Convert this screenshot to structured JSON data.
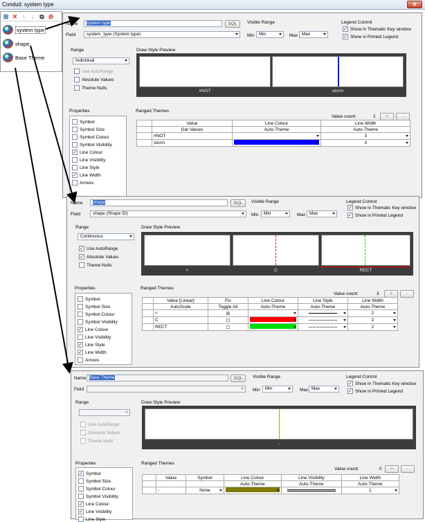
{
  "window": {
    "title": "Conduit: system type",
    "close_glyph": "✕"
  },
  "tree": {
    "items": [
      {
        "label": "system type",
        "selected": true
      },
      {
        "label": "shape",
        "selected": false
      },
      {
        "label": "Base Theme",
        "selected": false
      }
    ]
  },
  "labels": {
    "name": "Name",
    "field": "Field",
    "sql": "SQL",
    "visible_range": "Visible Range",
    "min": "Min",
    "max": "Max",
    "legend_control": "Legend Control",
    "show_thematic": "Show in Thematic Key window",
    "show_printed": "Show in Printed Legend",
    "range": "Range",
    "use_autorange": "Use AutoRange",
    "absolute_values": "Absolute Values",
    "theme_nulls": "Theme Nulls",
    "draw_style_preview": "Draw Style Preview",
    "properties": "Properties",
    "ranged_themes": "Ranged Themes",
    "value_count": "Value count:",
    "plus": "+",
    "minus": "-"
  },
  "panel1": {
    "name_value": "system type",
    "field_value": "system_type (System type)",
    "min_value": "Min",
    "max_value": "Max",
    "range_mode": "Individual",
    "value_count": "2",
    "preview_labels": [
      "#NOT",
      "storm"
    ],
    "properties": [
      {
        "label": "Symbol",
        "checked": false
      },
      {
        "label": "Symbol Size",
        "checked": false
      },
      {
        "label": "Symbol Colour",
        "checked": false
      },
      {
        "label": "Symbol Visibility",
        "checked": false
      },
      {
        "label": "Line Colour",
        "checked": true
      },
      {
        "label": "Line Visibility",
        "checked": false
      },
      {
        "label": "Line Style",
        "checked": false
      },
      {
        "label": "Line Width",
        "checked": true
      },
      {
        "label": "Arrows",
        "checked": false
      }
    ],
    "table": {
      "headers": [
        "Value",
        "Line Colour",
        "Line Width"
      ],
      "sub": [
        "Get Values",
        "Auto-Theme",
        "Auto-Theme"
      ],
      "rows": [
        {
          "value": "#NOT",
          "colour": "#ffffff",
          "width": "3"
        },
        {
          "value": "storm",
          "colour": "#0000ff",
          "width": "3"
        }
      ]
    }
  },
  "panel2": {
    "name_value": "shape",
    "field_value": "shape (Shape ID)",
    "min_value": "Min",
    "max_value": "Max",
    "range_mode": "Continuous",
    "value_count": "3",
    "preview_labels": [
      "<",
      "C",
      "RECT"
    ],
    "properties": [
      {
        "label": "Symbol",
        "checked": false
      },
      {
        "label": "Symbol Size",
        "checked": false
      },
      {
        "label": "Symbol Colour",
        "checked": false
      },
      {
        "label": "Symbol Visibility",
        "checked": false
      },
      {
        "label": "Line Colour",
        "checked": true
      },
      {
        "label": "Line Visibility",
        "checked": false
      },
      {
        "label": "Line Style",
        "checked": true
      },
      {
        "label": "Line Width",
        "checked": true
      },
      {
        "label": "Arrows",
        "checked": false
      }
    ],
    "table": {
      "headers": [
        "Value [Linear]",
        "Fix",
        "Line Colour",
        "Line Style",
        "Line Width"
      ],
      "sub": [
        "AutoScale",
        "Toggle All",
        "Auto-Theme",
        "Auto-Theme",
        "Auto-Theme"
      ],
      "rows": [
        {
          "value": "<",
          "fix": "☒",
          "colour": "#ffffff",
          "style": "solid",
          "width": "2"
        },
        {
          "value": "C",
          "fix": "☐",
          "colour": "#ff0000",
          "style": "dotted",
          "width": "2"
        },
        {
          "value": "RECT",
          "fix": "☐",
          "colour": "#00dd00",
          "style": "dotted",
          "width": "2"
        }
      ]
    }
  },
  "panel3": {
    "name_value": "Base Theme",
    "field_value": "",
    "min_value": "Min",
    "max_value": "Max",
    "range_mode": "",
    "value_count": "0",
    "preview_labels": [
      "-"
    ],
    "properties": [
      {
        "label": "Symbol",
        "checked": true
      },
      {
        "label": "Symbol Size",
        "checked": false
      },
      {
        "label": "Symbol Colour",
        "checked": false
      },
      {
        "label": "Symbol Visibility",
        "checked": false
      },
      {
        "label": "Line Colour",
        "checked": true
      },
      {
        "label": "Line Visibility",
        "checked": true
      },
      {
        "label": "Line Style",
        "checked": false
      }
    ],
    "table": {
      "headers": [
        "Value",
        "Symbol",
        "Line Colour",
        "Line Visibility",
        "Line Width"
      ],
      "sub": [
        "",
        "",
        "Auto-Theme",
        "Auto-Theme",
        "Auto-Theme"
      ],
      "rows": [
        {
          "value": "-",
          "symbol": "None",
          "colour": "#7f7a00",
          "visibility": "on",
          "width": "1"
        }
      ]
    }
  }
}
